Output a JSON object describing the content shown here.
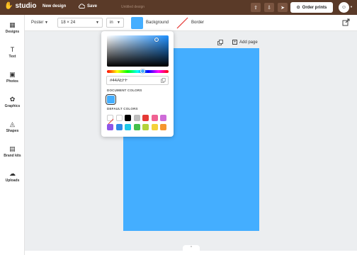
{
  "topbar": {
    "logo_text": "studio",
    "logo_mark": "✋",
    "new_design": "New design",
    "save": "Save",
    "doc_name": "Untitled design",
    "order_prints": "Order prints"
  },
  "sidebar": {
    "items": [
      {
        "label": "Designs",
        "icon": "layout-icon",
        "glyph": "▦"
      },
      {
        "label": "Text",
        "icon": "text-icon",
        "glyph": "T"
      },
      {
        "label": "Photos",
        "icon": "photo-icon",
        "glyph": "▣"
      },
      {
        "label": "Graphics",
        "icon": "graphics-icon",
        "glyph": "✿"
      },
      {
        "label": "Shapes",
        "icon": "shapes-icon",
        "glyph": "◬"
      },
      {
        "label": "Brand kits",
        "icon": "briefcase-icon",
        "glyph": "▤"
      },
      {
        "label": "Uploads",
        "icon": "upload-cloud-icon",
        "glyph": "☁"
      }
    ]
  },
  "toolbar": {
    "poster": "Poster",
    "size": "18 × 24",
    "unit": "in",
    "background": "Background",
    "border": "Border"
  },
  "canvas": {
    "add_page": "Add page",
    "page_color": "#44AEFF"
  },
  "color_picker": {
    "hex_value": "#44AEFF",
    "document_colors_label": "DOCUMENT COLORS",
    "default_colors_label": "DEFAULT COLORS",
    "document_colors": [
      "#44AEFF"
    ],
    "default_colors": [
      "none",
      "#FFFFFF",
      "#000000",
      "#BDBDBD",
      "#E53935",
      "#F06292",
      "#CE6BD8",
      "#8E55E8",
      "#2E8BE6",
      "#1EC8E8",
      "#43C04A",
      "#B5D33A",
      "#F4D13A",
      "#F5962E"
    ]
  }
}
